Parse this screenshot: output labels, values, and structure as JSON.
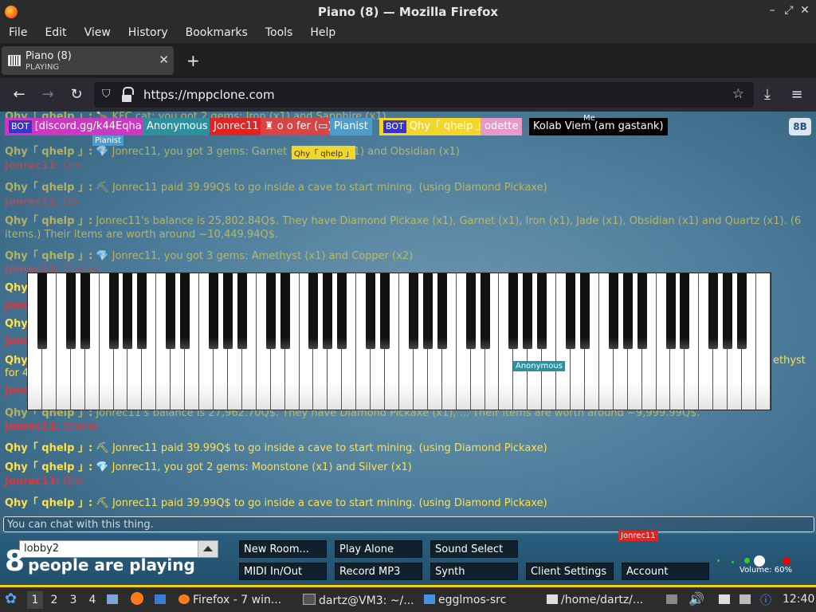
{
  "window": {
    "title": "Piano (8) — Mozilla Firefox",
    "min": "–",
    "restore": "⤢",
    "close": "✕"
  },
  "menu": [
    "File",
    "Edit",
    "View",
    "History",
    "Bookmarks",
    "Tools",
    "Help"
  ],
  "tab": {
    "title": "Piano (8)",
    "subtitle": "PLAYING",
    "close": "✕",
    "new": "+"
  },
  "nav": {
    "back": "←",
    "forward": "→",
    "reload": "↻",
    "url": "https://mppclone.com",
    "star": "☆",
    "download": "⤓",
    "menu": "≡"
  },
  "users": [
    {
      "badge": "BOT",
      "name": "[discord.gg/k44Eqha]",
      "color": "#c93ac1"
    },
    {
      "badge": "",
      "name": "Anonymous",
      "color": "#2f8f9d"
    },
    {
      "badge": "",
      "name": "Jonrec11",
      "color": "#e02323"
    },
    {
      "badge": "",
      "name": "♜ o o fer (▭)",
      "color": "#d84545"
    },
    {
      "badge": "",
      "name": "Pianist",
      "color": "#4d9ccc"
    },
    {
      "badge": "BOT",
      "name": "Qhy「 qhelp 」",
      "color": "#f2d62c"
    },
    {
      "badge": "",
      "name": "odette",
      "color": "#e79ac8"
    },
    {
      "badge": "",
      "name": "Kolab Viem (am gastank)",
      "color": "#000000"
    }
  ],
  "settings_label": "8B",
  "me_label": "Me",
  "chat": [
    {
      "nick": "Qhy「 qhelp 」:",
      "text": "🍗 KFC cat: you got 2 gems: Iron (x1) and Sapphire (x1)",
      "kind": "q",
      "fade": true
    },
    {
      "nick": "Qhy「 qhelp 」:",
      "text": "💎 Jonrec11, you got 3 gems: Garnet (x1), Jade (x1) and Obsidian (x1)",
      "kind": "q",
      "fade": true
    },
    {
      "nick": "Jonrec11:",
      "text": "Qm",
      "kind": "j",
      "fade": true
    },
    {
      "nick": "Qhy「 qhelp 」:",
      "text": "⛏ Jonrec11 paid 39.99Q$ to go inside a cave to start mining. (using Diamond Pickaxe)",
      "kind": "q",
      "fade": true
    },
    {
      "nick": "Jonrec11:",
      "text": "Qb",
      "kind": "j",
      "fade": true
    },
    {
      "nick": "Qhy「 qhelp 」:",
      "text": "Jonrec11's balance is 25,802.84Q$. They have Diamond Pickaxe (x1), Garnet (x1), Iron (x1), Jade (x1), Obsidian (x1) and Quartz (x1). (6 items.) Their items are worth around ~10,449.94Q$.",
      "kind": "q",
      "fade": true
    },
    {
      "nick": "Qhy「 qhelp 」:",
      "text": "💎 Jonrec11, you got 3 gems: Amethyst (x1) and Copper (x2)",
      "kind": "q",
      "fade": true
    },
    {
      "nick": "Jonrec11:",
      "text": "Qmine",
      "kind": "j",
      "fade": false
    },
    {
      "nick": "Qhy「 qhelp 」:",
      "text": "⛏ Jonrec11 paid 39.99Q$ to go inside a cave to start mining. (using Diamond Pickaxe)",
      "kind": "q",
      "fade": false
    },
    {
      "nick": "Qhy「 qhelp 」:",
      "text": "💎 Jonrec11, you got 2 gems: Moonstone (x1) and Silver (x1)",
      "kind": "q",
      "fade": false
    },
    {
      "nick": "Jonrec11:",
      "text": "Qm",
      "kind": "j",
      "fade": false
    },
    {
      "nick": "Qhy「 qhelp 」:",
      "text": "⛏ Jonrec11 paid 39.99Q$ to go inside a cave to start mining. (using Diamond Pickaxe)",
      "kind": "q",
      "fade": false
    }
  ],
  "hidden_chat": {
    "left_fragments": [
      "Qhy",
      "Jonr",
      "Qhy",
      "Jonr",
      "Qhy",
      "for 4",
      "Jonr"
    ],
    "right_fragment": "ethyst",
    "balance_line": {
      "nick": "Qhy「 qhelp 」:",
      "text": "Jonrec11's balance is 27,962.70Q$. They have Diamond Pickaxe (x1), ... Their items are worth around ~9,999.99Q$."
    },
    "balance_line_2": {
      "nick": "Jonrec11:",
      "text": "Qmine"
    }
  },
  "cursor_labels": [
    {
      "text": "Pianist",
      "color": "#4d9ccc"
    },
    {
      "text": "Qhy「 qhelp 」",
      "color": "#f2d62c"
    },
    {
      "text": "Anonymous",
      "color": "#2f8f9d"
    },
    {
      "text": "Jonrec11",
      "color": "#e02323"
    }
  ],
  "chat_placeholder": "You can chat with this thing.",
  "room": {
    "value": "lobby2"
  },
  "count": {
    "num": "8",
    "label": "people are playing"
  },
  "buttons": {
    "new_room": "New Room...",
    "play_alone": "Play Alone",
    "sound_select": "Sound Select",
    "midi": "MIDI In/Out",
    "record": "Record MP3",
    "synth": "Synth",
    "client_settings": "Client Settings",
    "account": "Account"
  },
  "volume": "Volume: 60%",
  "taskbar": {
    "workspaces": [
      "1",
      "2",
      "3",
      "4"
    ],
    "firefox": "Firefox - 7 win...",
    "terminal": "dartz@VM3: ~/...",
    "folder": "egglmos-src",
    "home": "/home/dartz/...",
    "clock": "12:40"
  }
}
